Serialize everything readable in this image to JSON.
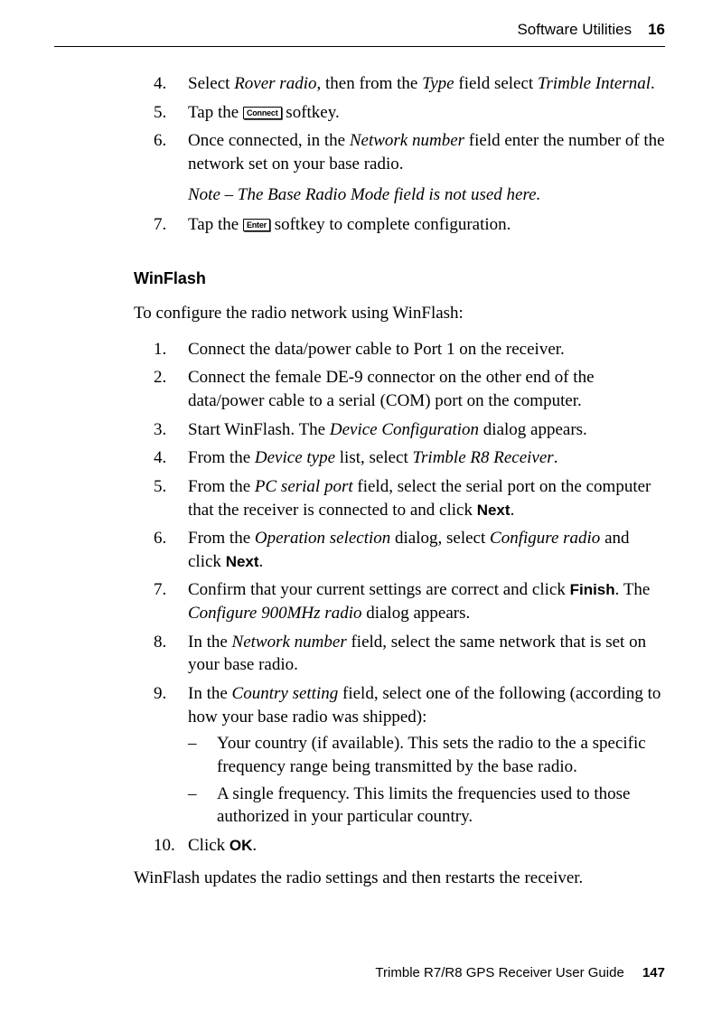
{
  "header": {
    "title": "Software Utilities",
    "chapter": "16"
  },
  "topList": {
    "item4": {
      "num": "4.",
      "pre": "Select ",
      "rover": "Rover radio",
      "mid": ", then from the ",
      "type": "Type",
      "mid2": " field select ",
      "trimble": "Trimble Internal",
      "post": "."
    },
    "item5": {
      "num": "5.",
      "pre": "Tap the ",
      "key": "Connect",
      "post": " softkey."
    },
    "item6": {
      "num": "6.",
      "pre": "Once connected, in the ",
      "nn": "Network number",
      "post": " field enter the number of the network set on your base radio."
    },
    "note": {
      "label": "Note – ",
      "text": "The Base Radio Mode field is not used here."
    },
    "item7": {
      "num": "7.",
      "pre": "Tap the ",
      "key": "Enter",
      "post": " softkey to complete configuration."
    }
  },
  "section": {
    "heading": "WinFlash",
    "intro": "To configure the radio network using WinFlash:"
  },
  "steps": {
    "s1": {
      "num": "1.",
      "text": "Connect the data/power cable to Port 1 on the receiver."
    },
    "s2": {
      "num": "2.",
      "text": "Connect the female DE-9 connector on the other end of the data/power cable to a serial (COM) port on the computer."
    },
    "s3": {
      "num": "3.",
      "pre": "Start WinFlash. The ",
      "dc": "Device Configuration",
      "post": " dialog appears."
    },
    "s4": {
      "num": "4.",
      "pre": "From the ",
      "dt": "Device type",
      "mid": " list, select ",
      "tr": "Trimble R8 Receiver",
      "post": "."
    },
    "s5": {
      "num": "5.",
      "pre": "From the ",
      "ps": "PC serial port",
      "mid": " field, select the serial port on the computer that the receiver is connected to and click ",
      "next": "Next",
      "post": "."
    },
    "s6": {
      "num": "6.",
      "pre": "From the ",
      "os": "Operation selection",
      "mid": " dialog, select ",
      "cr": "Configure radio",
      "mid2": " and click ",
      "next": "Next",
      "post": "."
    },
    "s7": {
      "num": "7.",
      "pre": "Confirm that your current settings are correct and click ",
      "finish": "Finish",
      "mid": ". The ",
      "c9": "Configure 900MHz radio",
      "post": " dialog appears."
    },
    "s8": {
      "num": "8.",
      "pre": "In the ",
      "nn": "Network number",
      "post": " field, select the same network that is set on your base radio."
    },
    "s9": {
      "num": "9.",
      "pre": "In the ",
      "cs": "Country setting",
      "post": " field, select one of the following (according to how your base radio was shipped):",
      "sub1": {
        "dash": "–",
        "text": "Your country (if available). This sets the radio to the a specific frequency range being transmitted by the base radio."
      },
      "sub2": {
        "dash": "–",
        "text": "A single frequency. This limits the frequencies used to those authorized in your particular country."
      }
    },
    "s10": {
      "num": "10.",
      "pre": "Click ",
      "ok": "OK",
      "post": "."
    }
  },
  "closing": "WinFlash updates the radio settings and then restarts the receiver.",
  "footer": {
    "text": "Trimble R7/R8 GPS Receiver User Guide",
    "page": "147"
  }
}
